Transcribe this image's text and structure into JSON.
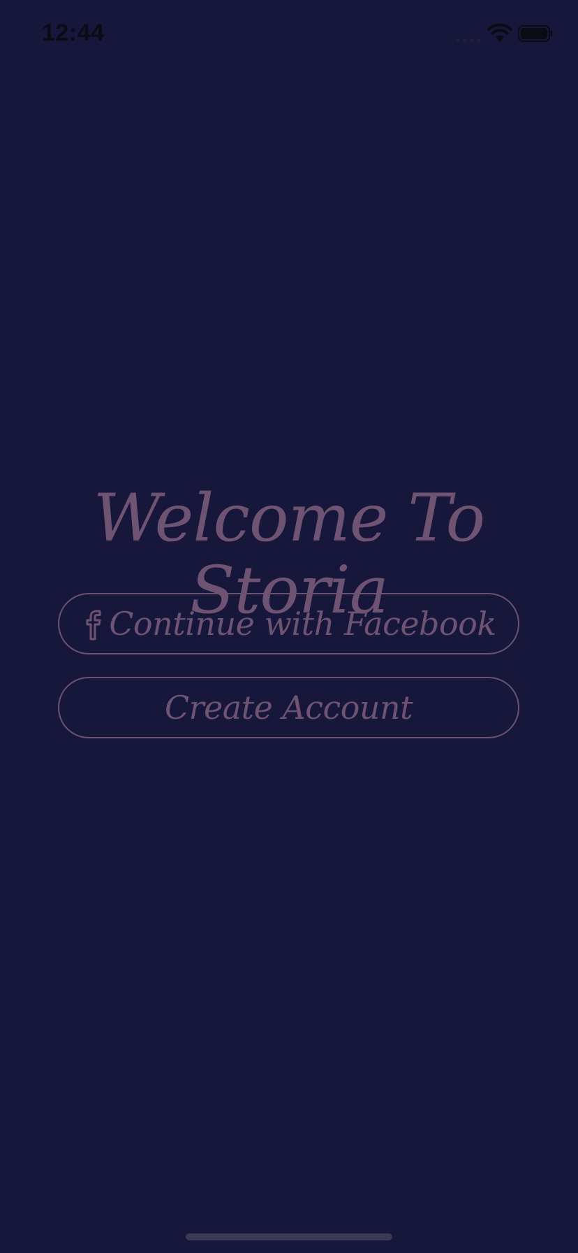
{
  "status_bar": {
    "time": "12:44",
    "icons": [
      "signal-icon",
      "wifi-icon",
      "battery-icon"
    ]
  },
  "welcome": {
    "title": "Welcome To Storia"
  },
  "buttons": {
    "facebook": {
      "label": "Continue with Facebook",
      "icon": "facebook-icon"
    },
    "create_account": {
      "label": "Create Account"
    }
  },
  "colors": {
    "background": "#17173b",
    "accent": "#6e5373",
    "status_text": "#0b0b16"
  }
}
